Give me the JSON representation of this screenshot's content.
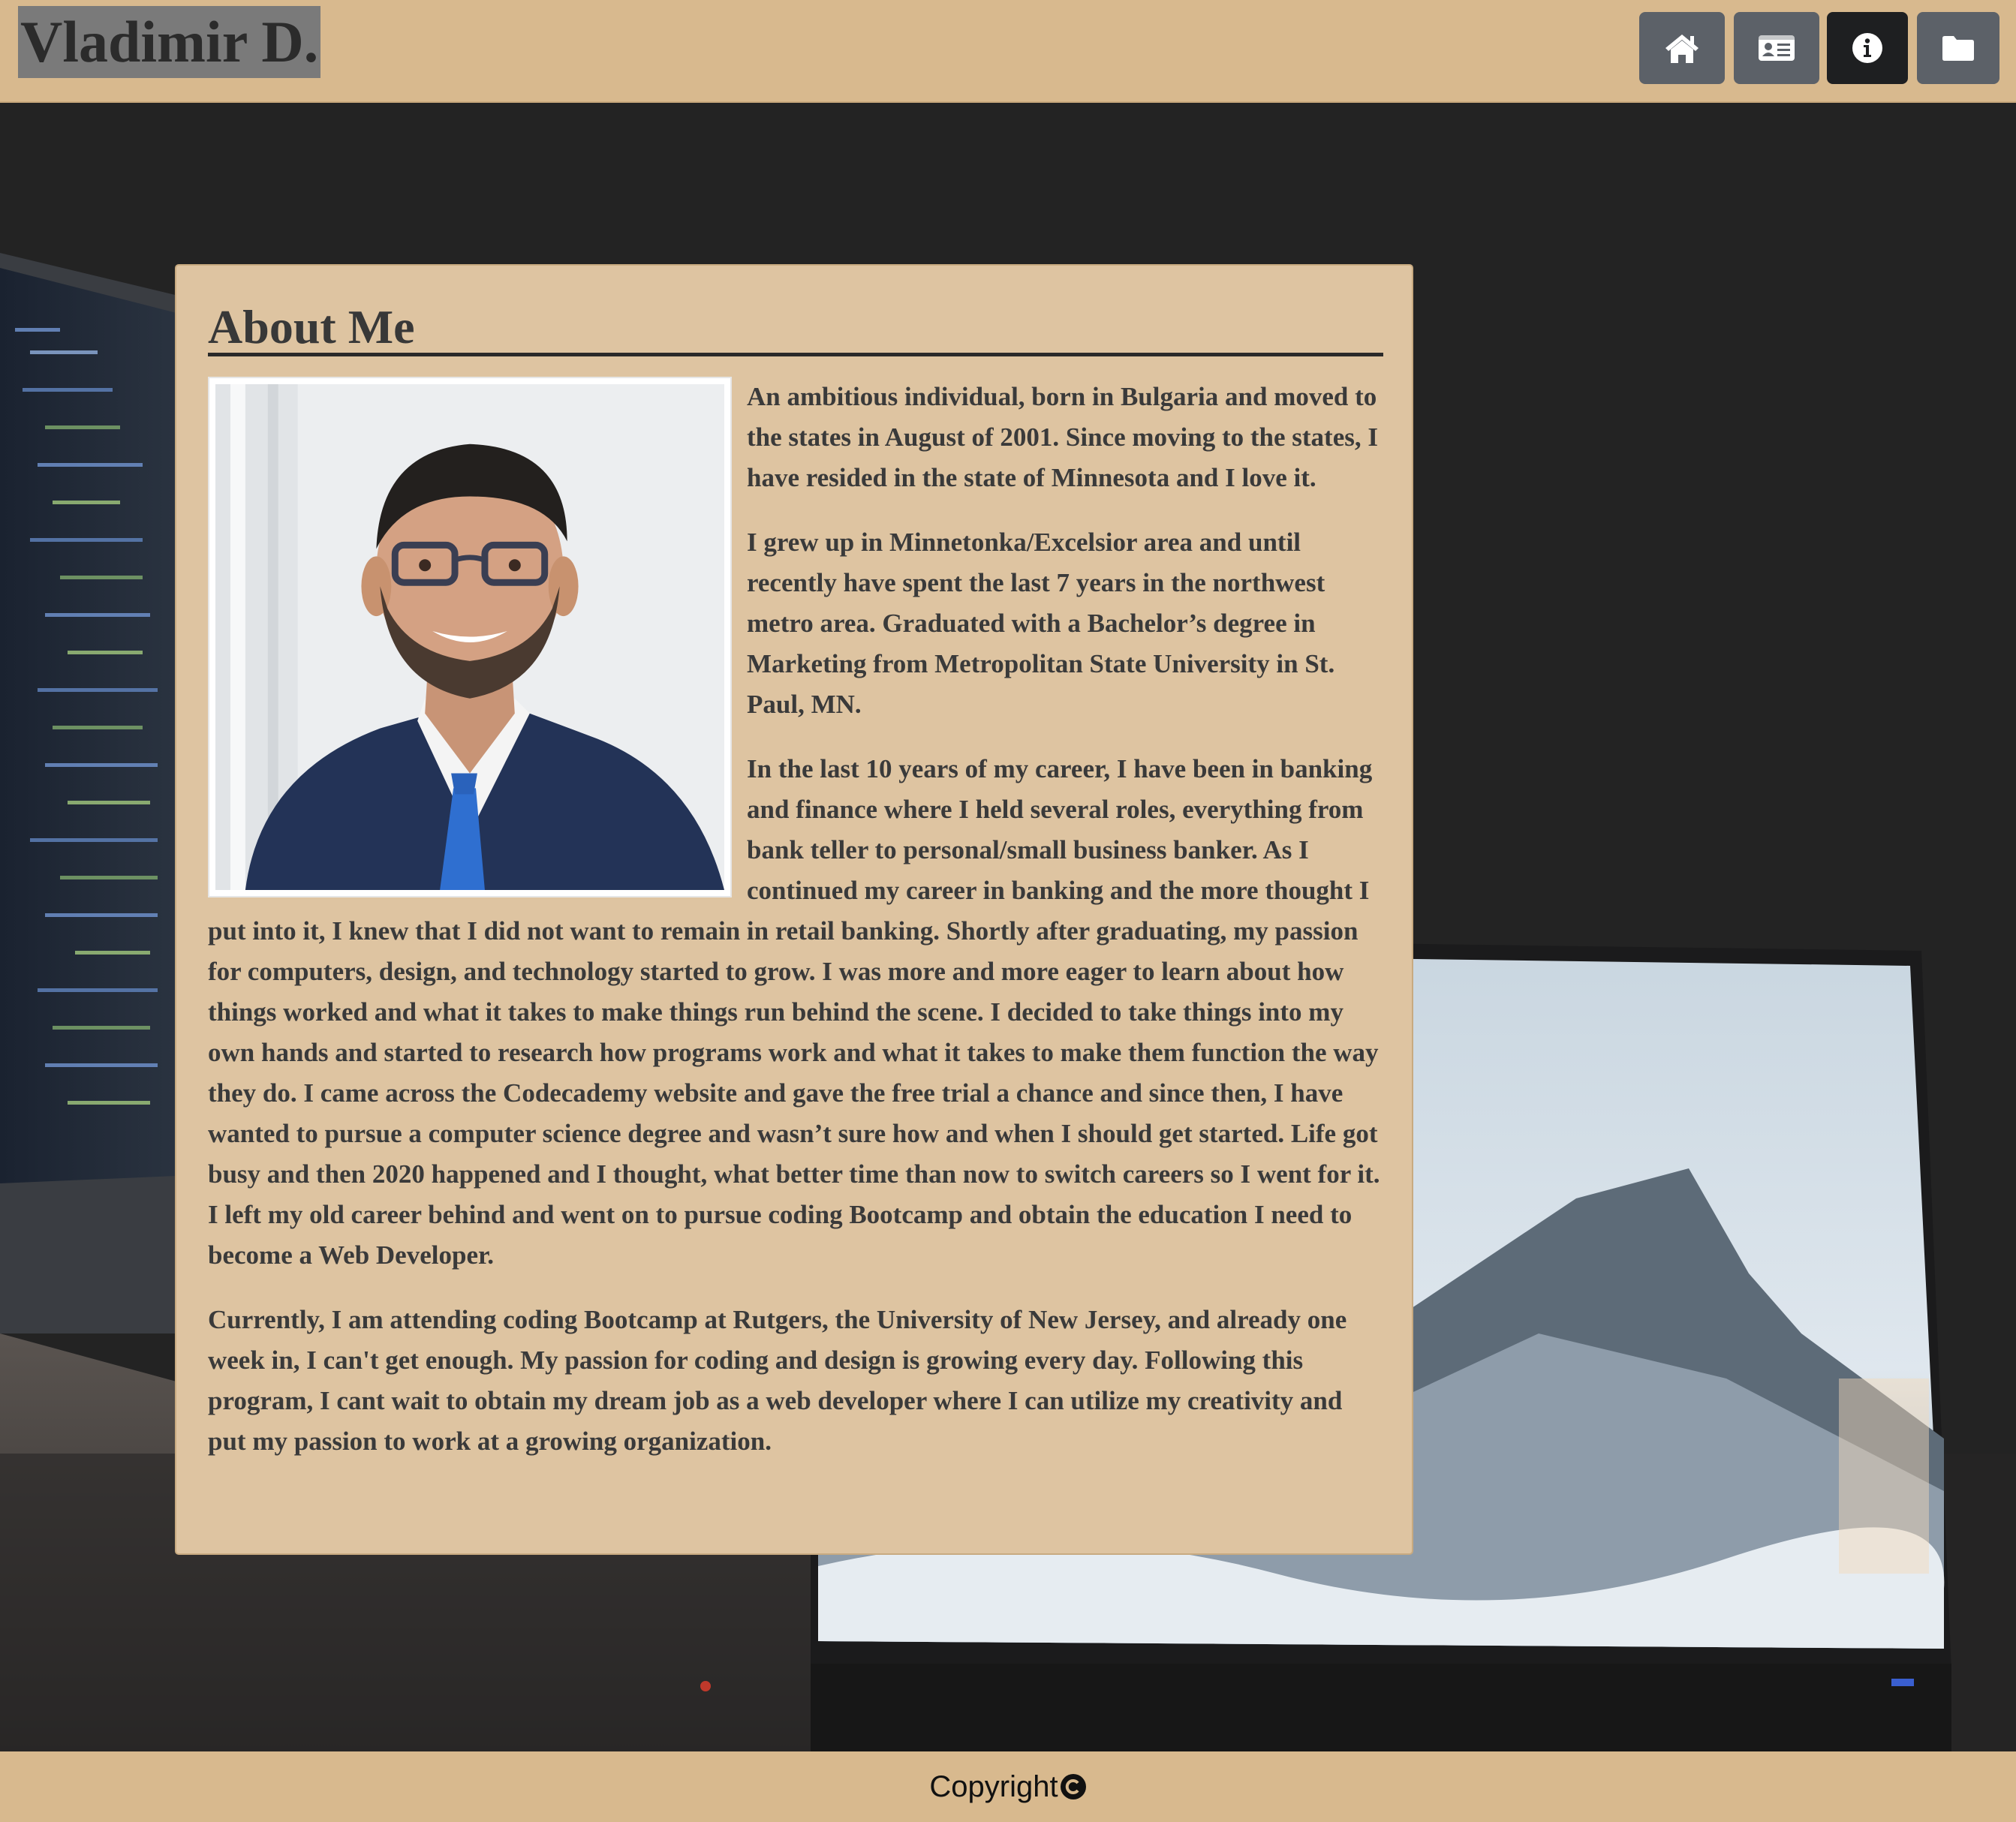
{
  "header": {
    "brand": "Vladimir D.",
    "nav": [
      {
        "icon": "home-icon",
        "label": ""
      },
      {
        "icon": "id-card-icon",
        "label": ""
      },
      {
        "icon": "info-icon",
        "label": ""
      },
      {
        "icon": "folder-icon",
        "label": ""
      }
    ],
    "colors": {
      "bar": "#d8b98e",
      "button": "#5c6168",
      "button_active": "#1e1f21"
    }
  },
  "about": {
    "title": "About Me",
    "paragraphs": [
      "An ambitious individual, born in Bulgaria and moved to the states in August of 2001. Since moving to the states, I have resided in the state of Minnesota and I love it.",
      "I grew up in Minnetonka/Excelsior area and until recently have spent the last 7 years in the northwest metro area. Graduated with a Bachelor’s degree in Marketing from Metropolitan State University in St. Paul, MN.",
      "In the last 10 years of my career, I have been in banking and finance where I held several roles, everything from bank teller to personal/small business banker. As I continued my career in banking and the more thought I put into it, I knew that I did not want to remain in retail banking. Shortly after graduating, my passion for computers, design, and technology started to grow. I was more and more eager to learn about how things worked and what it takes to make things run behind the scene. I decided to take things into my own hands and started to research how programs work and what it takes to make them function the way they do. I came across the Codecademy website and gave the free trial a chance and since then, I have wanted to pursue a computer science degree and wasn’t sure how and when I should get started. Life got busy and then 2020 happened and I thought, what better time than now to switch careers so I went for it. I left my old career behind and went on to pursue coding Bootcamp and obtain the education I need to become a Web Developer.",
      "Currently, I am attending coding Bootcamp at Rutgers, the University of New Jersey, and already one week in, I can't get enough. My passion for coding and design is growing every day. Following this program, I cant wait to obtain my dream job as a web developer where I can utilize my creativity and put my passion to work at a growing organization."
    ],
    "colors": {
      "card": "#dec4a1",
      "text": "#3a3a3a"
    }
  },
  "footer": {
    "text": "Copyright",
    "icon": "copyright-icon"
  }
}
